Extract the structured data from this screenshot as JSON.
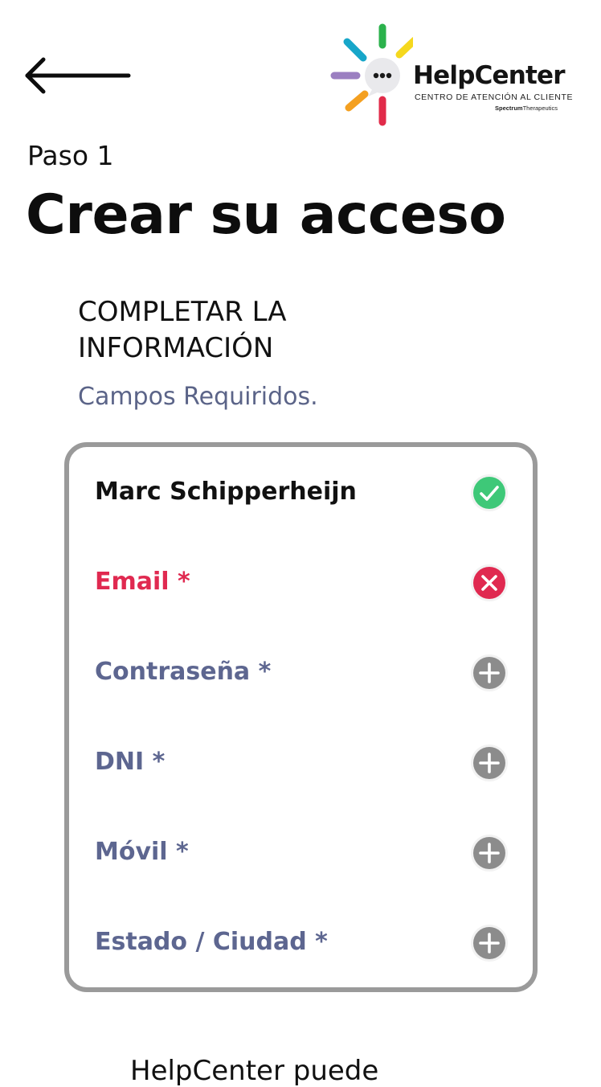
{
  "header": {
    "back_label": "back"
  },
  "logo": {
    "title": "HelpCenter",
    "subtitle": "CENTRO DE ATENCIÓN AL CLIENTE",
    "brand_bold": "Spectrum",
    "brand_light": "Therapeutics",
    "ray_colors": [
      "#2bb24c",
      "#f5d81e",
      "#e12b4a",
      "#f4a020",
      "#9b7fc1",
      "#17a6c9"
    ]
  },
  "step": {
    "label": "Paso 1"
  },
  "title": "Crear su acceso",
  "section": {
    "heading": "COMPLETAR LA INFORMACIÓN",
    "required_note": "Campos Requiridos."
  },
  "fields": [
    {
      "label": "Marc Schipperheijn",
      "status": "valid",
      "icon": "check-circle-icon",
      "color": "#111111"
    },
    {
      "label": "Email *",
      "status": "error",
      "icon": "x-circle-icon",
      "color": "#e02950"
    },
    {
      "label": "Contraseña *",
      "status": "empty",
      "icon": "plus-circle-icon",
      "color": "#5d6690"
    },
    {
      "label": "DNI *",
      "status": "empty",
      "icon": "plus-circle-icon",
      "color": "#5d6690"
    },
    {
      "label": "Móvil *",
      "status": "empty",
      "icon": "plus-circle-icon",
      "color": "#5d6690"
    },
    {
      "label": "Estado / Ciudad *",
      "status": "empty",
      "icon": "plus-circle-icon",
      "color": "#5d6690"
    }
  ],
  "status_colors": {
    "valid": "#3ec878",
    "error": "#e02950",
    "empty": "#8c8c8c"
  },
  "footer": {
    "partial_text": "HelpCenter puede"
  }
}
